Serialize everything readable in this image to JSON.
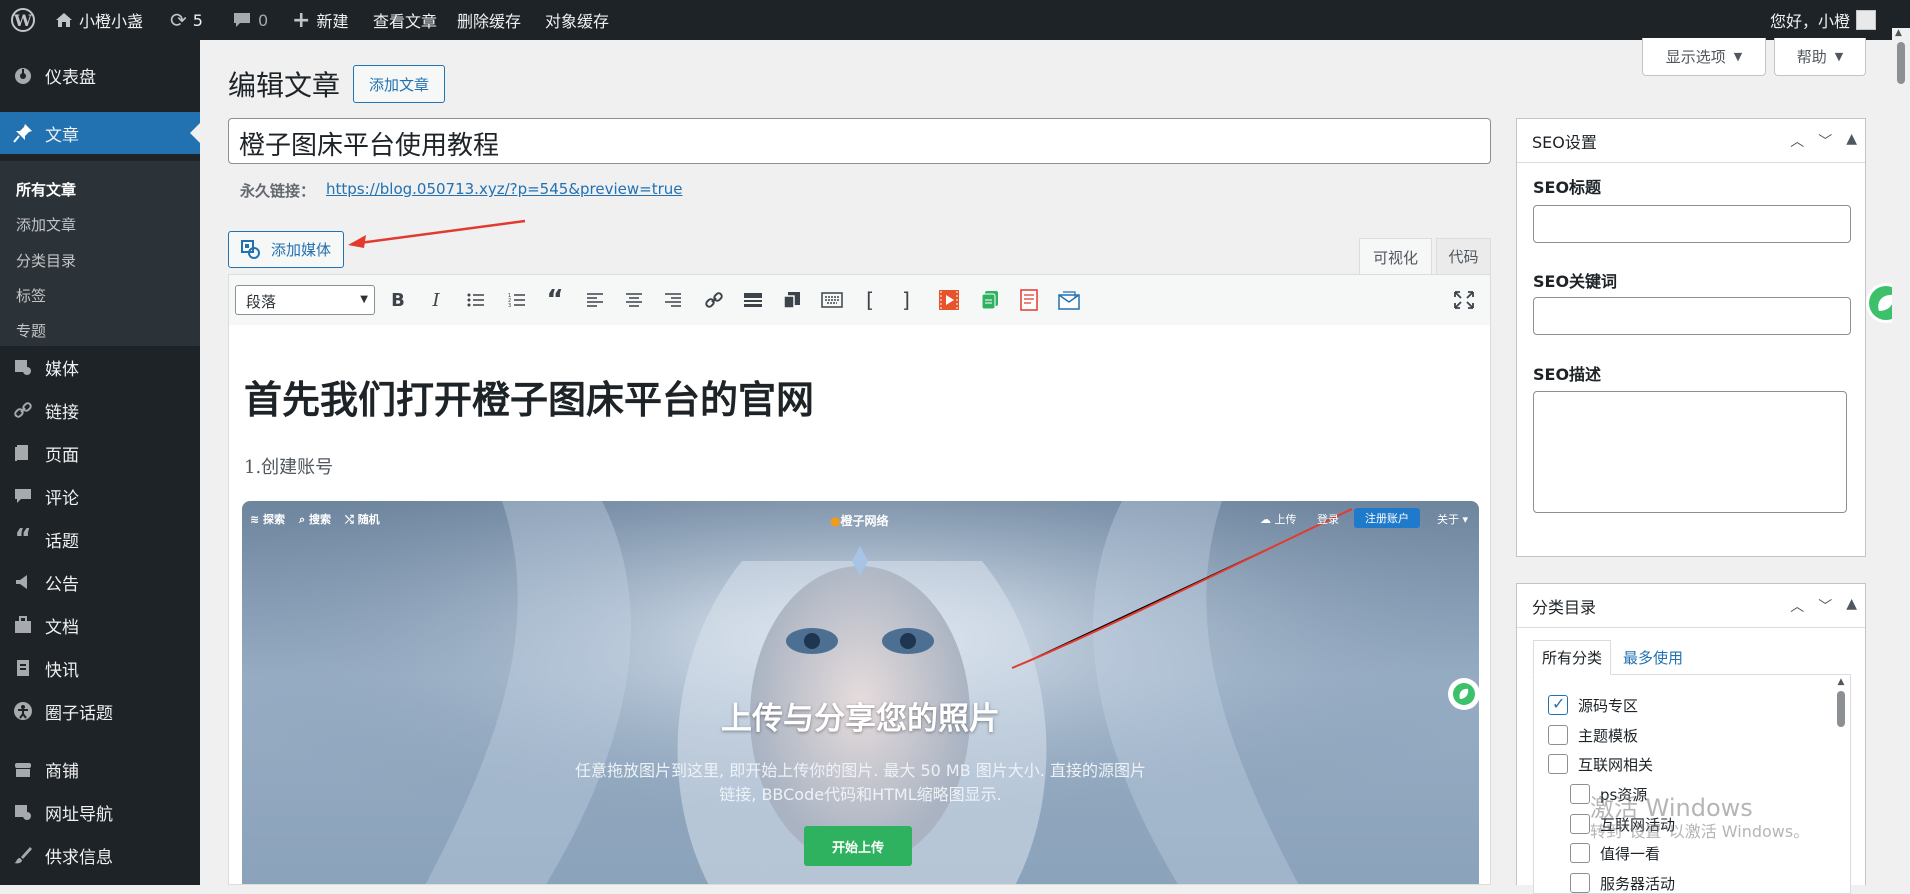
{
  "adminbar": {
    "site_name": "小橙小盏",
    "updates": "5",
    "comments": "0",
    "new": "新建",
    "view_post": "查看文章",
    "clear_cache": "删除缓存",
    "object_cache": "对象缓存",
    "greeting": "您好，小橙"
  },
  "sidebar": {
    "dashboard": "仪表盘",
    "posts": "文章",
    "sub": [
      "所有文章",
      "添加文章",
      "分类目录",
      "标签",
      "专题"
    ],
    "media": "媒体",
    "links": "链接",
    "pages": "页面",
    "comments": "评论",
    "topics": "话题",
    "notice": "公告",
    "docs": "文档",
    "news": "快讯",
    "circle": "圈子话题",
    "shop": "商铺",
    "nav": "网址导航",
    "supply": "供求信息"
  },
  "header": {
    "title": "编辑文章",
    "add_new": "添加文章",
    "screen_options": "显示选项",
    "help": "帮助"
  },
  "post": {
    "title": "橙子图床平台使用教程",
    "permalink_label": "永久链接：",
    "permalink": "https://blog.050713.xyz/?p=545&preview=true",
    "add_media": "添加媒体",
    "tab_visual": "可视化",
    "tab_code": "代码",
    "format": "段落"
  },
  "content": {
    "heading": "首先我们打开橙子图床平台的官网",
    "step": "1.创建账号"
  },
  "shot": {
    "explore": "探索",
    "search": "搜索",
    "random": "随机",
    "brand": "橙子网络",
    "upload": "上传",
    "login": "登录",
    "register": "注册账户",
    "about": "关于",
    "headline": "上传与分享您的照片",
    "desc1": "任意拖放图片到这里, 即开始上传你的图片. 最大 50 MB 图片大小. 直接的源图片",
    "desc2": "链接, BBCode代码和HTML缩略图显示.",
    "start": "开始上传"
  },
  "seo": {
    "title": "SEO设置",
    "seo_title": "SEO标题",
    "seo_keywords": "SEO关键词",
    "seo_desc": "SEO描述"
  },
  "category": {
    "title": "分类目录",
    "tab_all": "所有分类",
    "tab_most": "最多使用",
    "items": [
      "源码专区",
      "主题模板",
      "互联网相关",
      "ps资源",
      "互联网活动",
      "值得一看",
      "服务器活动"
    ]
  },
  "watermark": {
    "line1": "激活 Windows",
    "line2": "转到\"设置\"以激活 Windows。"
  },
  "colors": {
    "admin_dark": "#1d2327",
    "accent": "#2271b1",
    "register": "#1f7acb",
    "start": "#2fb25f",
    "arrow": "#e23a2e"
  }
}
